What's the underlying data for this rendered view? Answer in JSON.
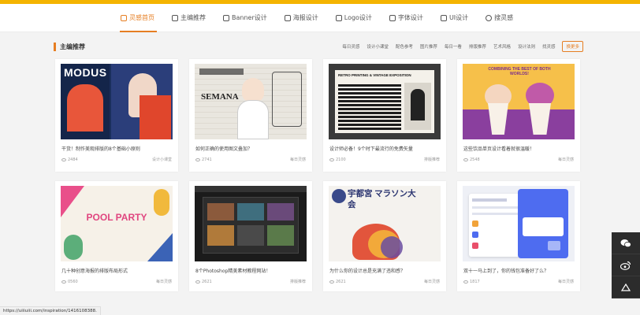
{
  "nav": {
    "items": [
      {
        "label": "灵感首页",
        "active": true
      },
      {
        "label": "主编推荐"
      },
      {
        "label": "Banner设计"
      },
      {
        "label": "海报设计"
      },
      {
        "label": "Logo设计"
      },
      {
        "label": "字体设计"
      },
      {
        "label": "UI设计"
      },
      {
        "label": "搜灵感"
      }
    ],
    "accent": "#e67e22"
  },
  "section": {
    "title": "主编推荐",
    "filters": [
      "每日灵感",
      "设计小课堂",
      "配色参考",
      "图片推荐",
      "每日一看",
      "排版推荐",
      "艺术风格",
      "设计法则",
      "找灵感"
    ],
    "more_label": "换更多"
  },
  "cards": [
    {
      "title": "干货！制作美观排版的8个基础小原则",
      "views": "2484",
      "tag": "设计小课堂",
      "thumb_text": "MODUS"
    },
    {
      "title": "如何正确的使用图文叠加？",
      "views": "2741",
      "tag": "每日灵感",
      "thumb_text": "SEMANA"
    },
    {
      "title": "设计师必备！9个时下最流行的免费矢量",
      "views": "2100",
      "tag": "排版推荐",
      "thumb_text": "RETRO PRINTING & VINTAGE EXPOSITION"
    },
    {
      "title": "这些饮品单页设计看着就很温暖！",
      "views": "2548",
      "tag": "每日灵感",
      "thumb_text": "COMBINING THE BEST OF BOTH WORLDS!"
    },
    {
      "title": "几十种创意海报的排版布局形式",
      "views": "0560",
      "tag": "每日灵感",
      "thumb_text": "POOL PARTY"
    },
    {
      "title": "8个Photoshop精美素材教程网站！",
      "views": "2621",
      "tag": "排版推荐",
      "thumb_text": ""
    },
    {
      "title": "为什么你的设计总是充满了违和感？",
      "views": "2621",
      "tag": "每日灵感",
      "thumb_text": "宇都宮 マラソン大会"
    },
    {
      "title": "双十一马上到了，你的钱包准备好了么？",
      "views": "1817",
      "tag": "每日灵感",
      "thumb_text": ""
    }
  ],
  "status_url": "https://uiiiuiii.com/inspiration/1416108388.",
  "side_tools": [
    "wechat-icon",
    "weibo-icon",
    "back-to-top-icon"
  ]
}
